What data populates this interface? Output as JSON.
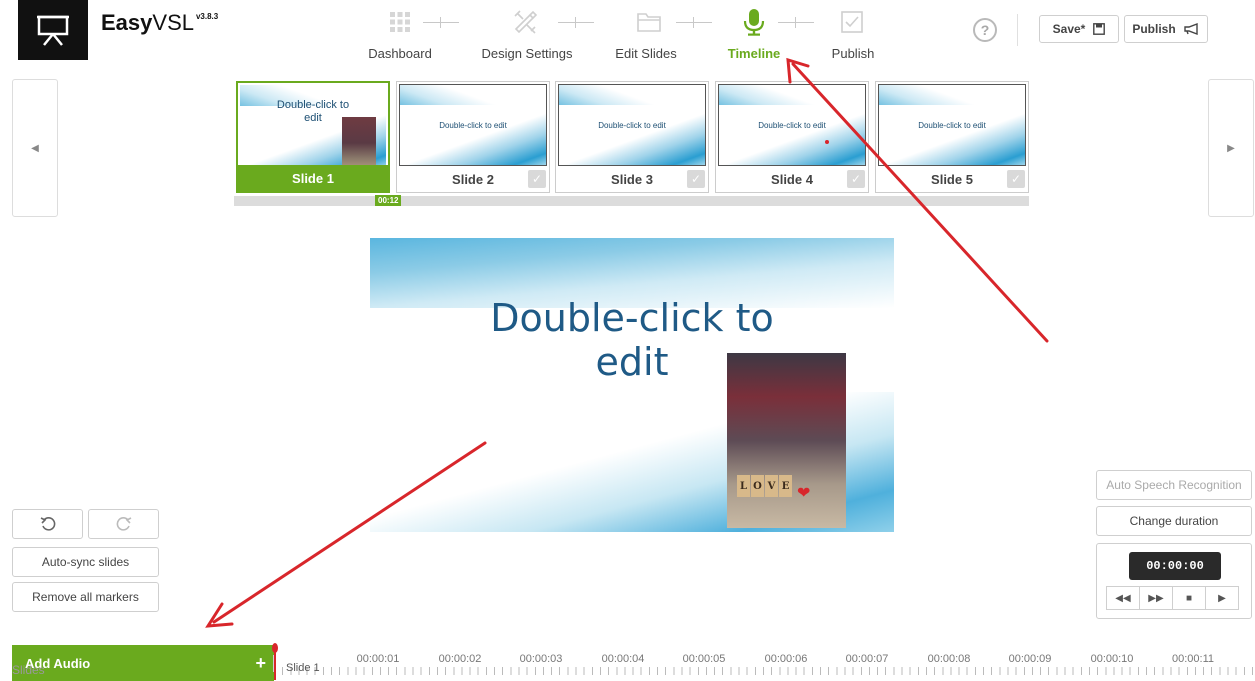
{
  "app": {
    "brand_bold": "Easy",
    "brand_light": "VSL",
    "version": "v3.8.3"
  },
  "steps": [
    {
      "label": "Dashboard",
      "icon": "dashboard-grid-icon",
      "active": false
    },
    {
      "label": "Design Settings",
      "icon": "design-tools-icon",
      "active": false
    },
    {
      "label": "Edit Slides",
      "icon": "folder-icon",
      "active": false
    },
    {
      "label": "Timeline",
      "icon": "microphone-icon",
      "active": true
    },
    {
      "label": "Publish",
      "icon": "checkbox-icon",
      "active": false
    }
  ],
  "header_buttons": {
    "save": "Save*",
    "publish": "Publish"
  },
  "slides": [
    {
      "label": "Slide 1",
      "text": "Double-click to edit",
      "active": true
    },
    {
      "label": "Slide 2",
      "text": "Double-click to edit",
      "active": false
    },
    {
      "label": "Slide 3",
      "text": "Double-click to edit",
      "active": false
    },
    {
      "label": "Slide 4",
      "text": "Double-click to edit",
      "active": false
    },
    {
      "label": "Slide 5",
      "text": "Double-click to edit",
      "active": false
    }
  ],
  "timeline_tag": "00:12",
  "preview": {
    "title": "Double-click to edit",
    "photo_letters": [
      "L",
      "O",
      "V",
      "E"
    ]
  },
  "left_controls": {
    "auto_sync": "Auto-sync slides",
    "remove_markers": "Remove all markers",
    "add_audio": "Add Audio",
    "add_audio_plus": "+",
    "slides_label": "Slides"
  },
  "right_controls": {
    "auto_speech": "Auto Speech Recognition",
    "change_duration": "Change duration",
    "time": "00:00:00"
  },
  "ruler": {
    "labels": [
      "00:00:01",
      "00:00:02",
      "00:00:03",
      "00:00:04",
      "00:00:05",
      "00:00:06",
      "00:00:07",
      "00:00:08",
      "00:00:09",
      "00:00:10",
      "00:00:11"
    ],
    "track_label": "Slide 1"
  },
  "colors": {
    "accent": "#6aaa1e",
    "annotation_arrow": "#d8262b"
  }
}
